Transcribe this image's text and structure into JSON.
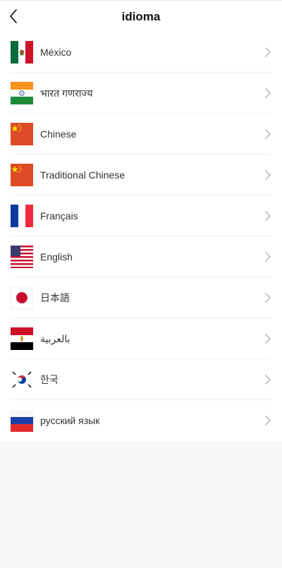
{
  "header": {
    "title": "idioma"
  },
  "icons": {
    "back": "chevron-left-icon",
    "row_arrow": "chevron-right-icon"
  },
  "colors": {
    "background": "#f7f7f7",
    "surface": "#ffffff",
    "text": "#333333",
    "chevron": "#b3b3b3"
  },
  "languages": [
    {
      "label": "México",
      "flag": "mexico-flag-icon"
    },
    {
      "label": "भारत गणराज्य",
      "flag": "india-flag-icon"
    },
    {
      "label": "Chinese",
      "flag": "china-flag-icon"
    },
    {
      "label": "Traditional Chinese",
      "flag": "china-flag-icon"
    },
    {
      "label": "Français",
      "flag": "france-flag-icon"
    },
    {
      "label": "English",
      "flag": "usa-flag-icon"
    },
    {
      "label": "日本語",
      "flag": "japan-flag-icon"
    },
    {
      "label": "بالعربية",
      "flag": "egypt-flag-icon"
    },
    {
      "label": "한국",
      "flag": "korea-flag-icon"
    },
    {
      "label": "русский язык",
      "flag": "russia-flag-icon"
    }
  ]
}
